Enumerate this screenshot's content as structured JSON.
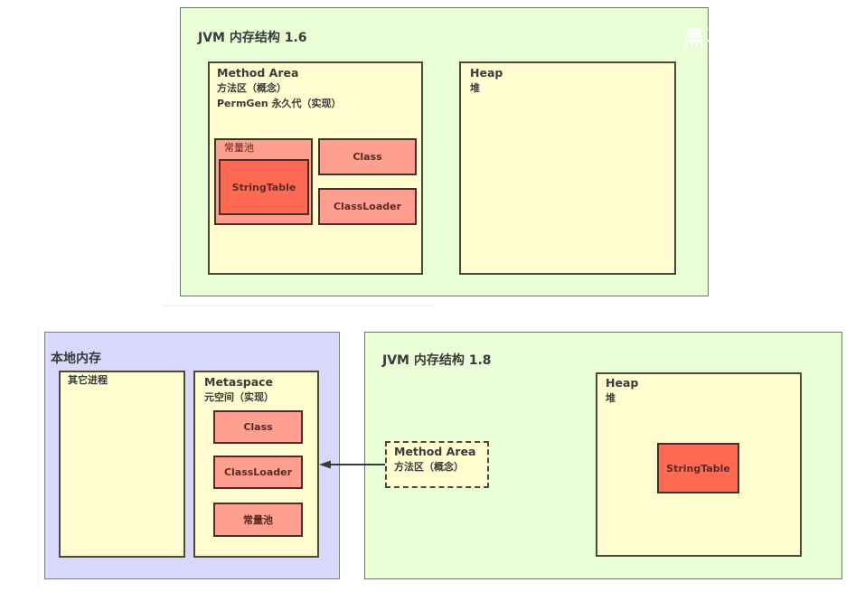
{
  "colors": {
    "jvm_panel_bg": "#e9fdd6",
    "native_panel_bg": "#d8d8fc",
    "area_bg": "#fffdd0",
    "component_bg": "#ff9f90",
    "string_table_bg": "#ff6a55",
    "border": "#4a4a3a"
  },
  "watermark": "黑马程序员",
  "jvm16": {
    "title": "JVM 内存结构 1.6",
    "method_area": {
      "title": "Method Area",
      "subtitle": "方法区（概念）",
      "impl": "PermGen 永久代（实现）",
      "constant_pool": {
        "label": "常量池",
        "string_table": "StringTable"
      },
      "class": "Class",
      "classloader": "ClassLoader"
    },
    "heap": {
      "title": "Heap",
      "subtitle": "堆"
    }
  },
  "native": {
    "title": "本地内存",
    "other_processes": "其它进程",
    "metaspace": {
      "title": "Metaspace",
      "subtitle": "元空间（实现）",
      "class": "Class",
      "classloader": "ClassLoader",
      "constant_pool": "常量池"
    }
  },
  "jvm18": {
    "title": "JVM 内存结构 1.8",
    "method_area": {
      "title": "Method Area",
      "subtitle": "方法区（概念）"
    },
    "heap": {
      "title": "Heap",
      "subtitle": "堆",
      "string_table": "StringTable"
    }
  }
}
